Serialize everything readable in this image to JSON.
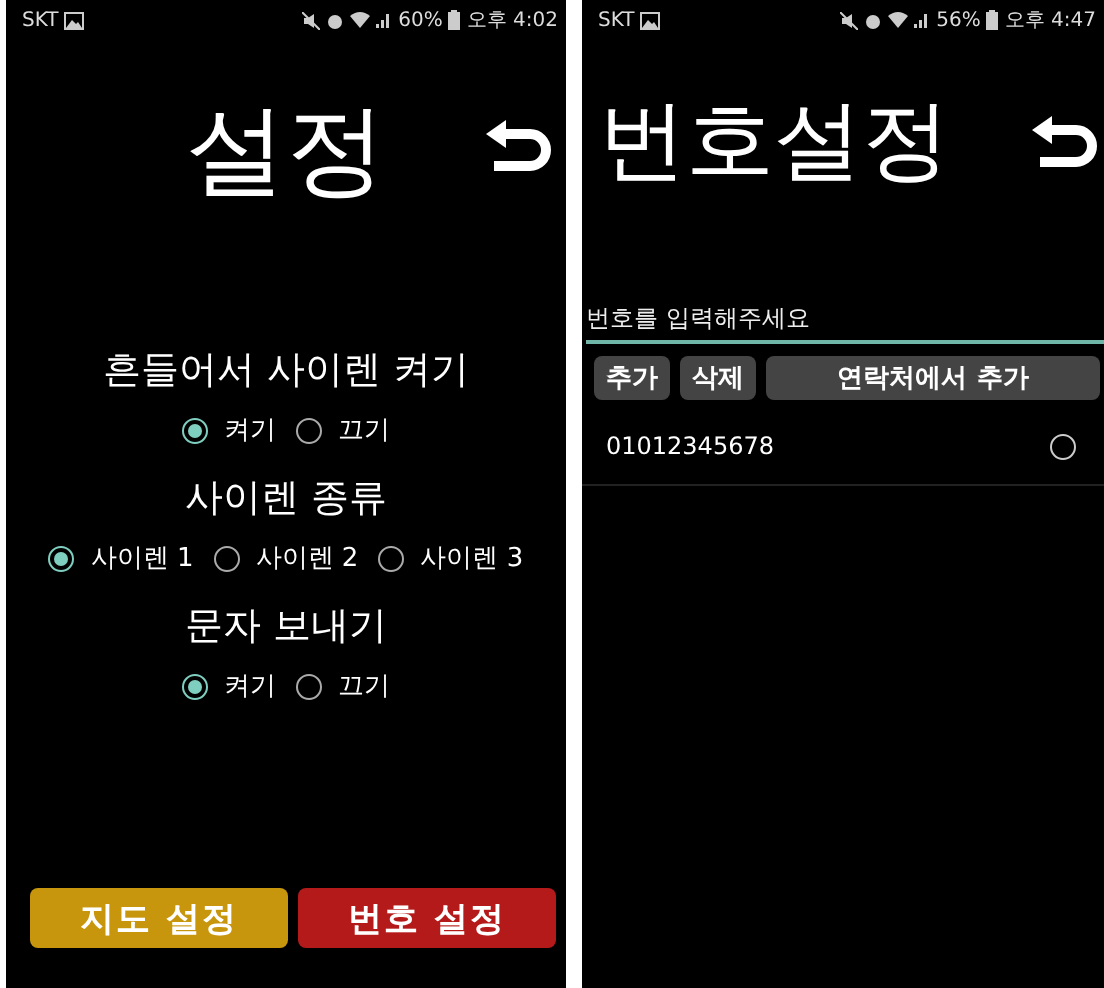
{
  "settings_screen": {
    "status_bar": {
      "carrier": "SKT",
      "battery": "60%",
      "time": "오후 4:02"
    },
    "title": "설정",
    "sections": [
      {
        "heading": "흔들어서 사이렌 켜기",
        "options": [
          {
            "label": "켜기",
            "selected": true
          },
          {
            "label": "끄기",
            "selected": false
          }
        ]
      },
      {
        "heading": "사이렌 종류",
        "options": [
          {
            "label": "사이렌 1",
            "selected": true
          },
          {
            "label": "사이렌 2",
            "selected": false
          },
          {
            "label": "사이렌 3",
            "selected": false
          }
        ]
      },
      {
        "heading": "문자 보내기",
        "options": [
          {
            "label": "켜기",
            "selected": true
          },
          {
            "label": "끄기",
            "selected": false
          }
        ]
      }
    ],
    "buttons": [
      {
        "label": "지도 설정",
        "color": "#c8960c"
      },
      {
        "label": "번호 설정",
        "color": "#b51a1a"
      }
    ]
  },
  "number_screen": {
    "status_bar": {
      "carrier": "SKT",
      "battery": "56%",
      "time": "오후 4:47"
    },
    "title": "번호설정",
    "input": {
      "placeholder": "번호를 입력해주세요"
    },
    "buttons": [
      "추가",
      "삭제",
      "연락처에서 추가"
    ],
    "numbers": [
      {
        "number": "01012345678",
        "selected": false
      }
    ]
  }
}
